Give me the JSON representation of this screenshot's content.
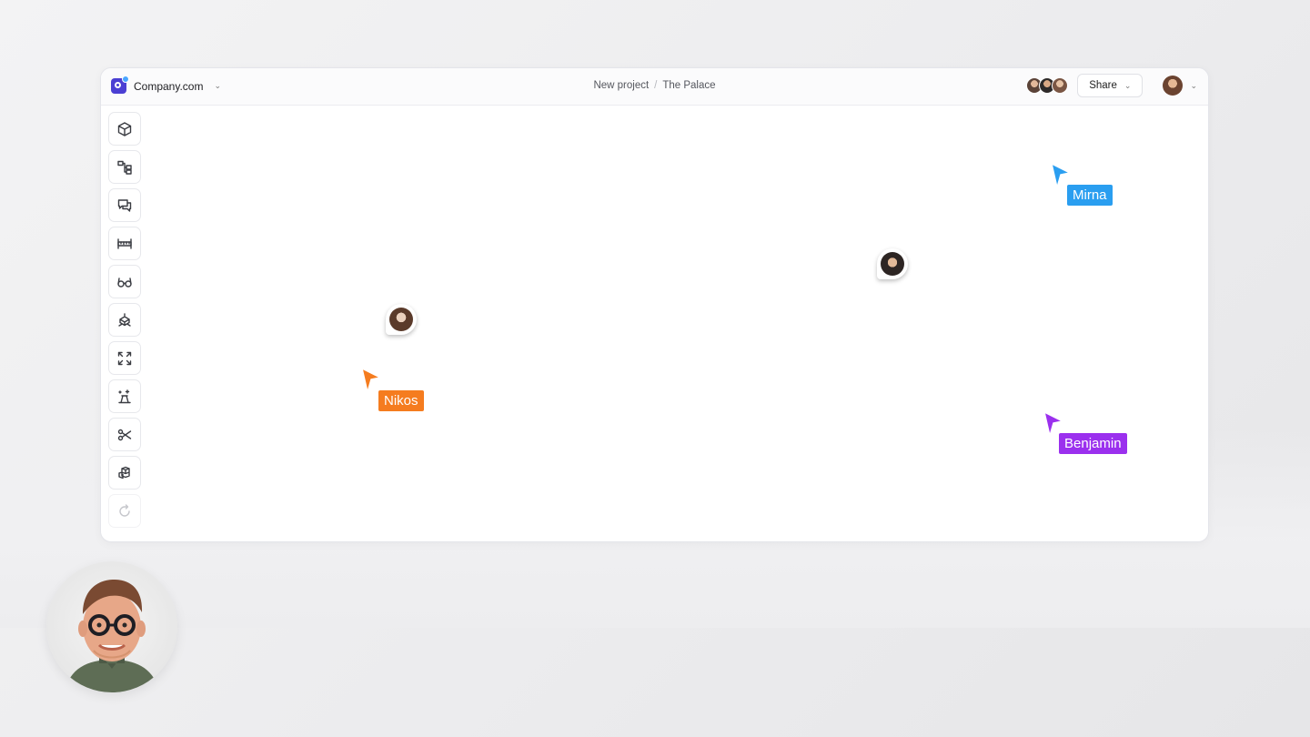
{
  "app": {
    "workspace_name": "Company.com",
    "breadcrumbs": [
      "New project",
      "The Palace"
    ],
    "share_label": "Share"
  },
  "toolbar": {
    "tools": [
      {
        "icon": "cube-icon"
      },
      {
        "icon": "hierarchy-icon"
      },
      {
        "icon": "comments-icon"
      },
      {
        "icon": "ruler-icon"
      },
      {
        "icon": "glasses-icon"
      },
      {
        "icon": "section-box-icon"
      },
      {
        "icon": "fullscreen-icon"
      },
      {
        "icon": "ai-generate-icon"
      },
      {
        "icon": "scissors-icon"
      },
      {
        "icon": "objects-icon"
      },
      {
        "icon": "rotate-icon"
      }
    ]
  },
  "collaborators": {
    "cursors": [
      {
        "name": "Mirna",
        "color": "#2a9ef0"
      },
      {
        "name": "Nikos",
        "color": "#f57c1f"
      },
      {
        "name": "Benjamin",
        "color": "#9b30ee"
      }
    ]
  },
  "colors": {
    "accent": "#4b3fd3",
    "roof_cyan": "#9fd6e6",
    "roof_magenta": "#ee5ed3",
    "facade_blue": "#4a88b3"
  }
}
